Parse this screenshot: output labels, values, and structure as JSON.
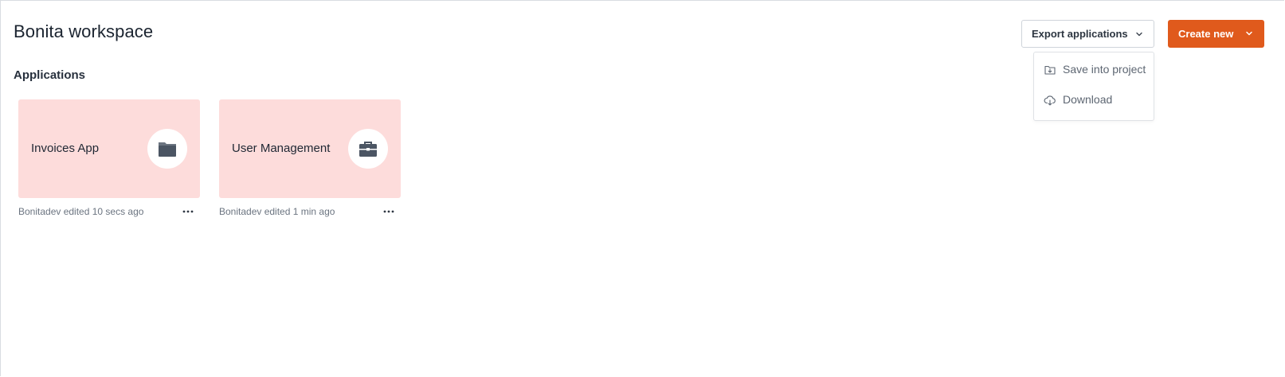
{
  "header": {
    "title": "Bonita workspace",
    "export_label": "Export applications",
    "create_label": "Create new"
  },
  "export_menu": {
    "items": [
      {
        "label": "Save into project",
        "icon": "save-into-project-icon"
      },
      {
        "label": "Download",
        "icon": "cloud-download-icon"
      }
    ]
  },
  "applications": {
    "heading": "Applications",
    "cards": [
      {
        "name": "Invoices App",
        "icon": "folder-icon",
        "meta": "Bonitadev edited 10 secs ago"
      },
      {
        "name": "User Management",
        "icon": "briefcase-icon",
        "meta": "Bonitadev edited 1 min ago"
      }
    ]
  },
  "colors": {
    "accent": "#e05a1c",
    "card_bg": "#fddcdb",
    "icon_dark": "#4b5563"
  }
}
